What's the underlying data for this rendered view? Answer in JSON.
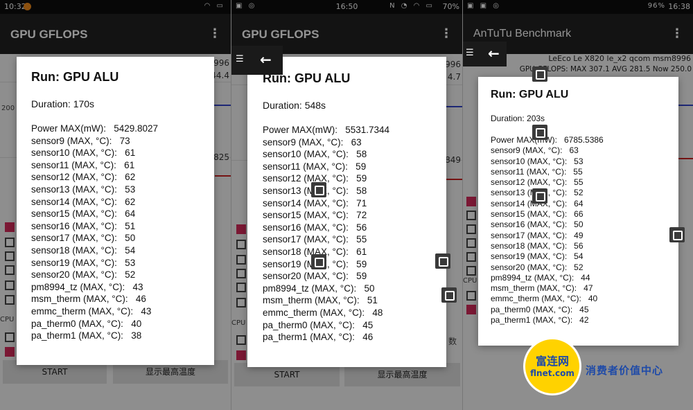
{
  "panel1": {
    "status": {
      "time": "10:32"
    },
    "app_title": "GPU GFLOPS",
    "bg": {
      "num_a": "996",
      "num_b": "44.4",
      "num_c": "825",
      "num_d": "CPU",
      "btn_start": "START",
      "btn_temp": "显示最高温度"
    },
    "dialog": {
      "title": "Run: GPU ALU",
      "duration": "Duration: 170s",
      "rows": [
        "Power MAX(mW):   5429.8027",
        "sensor9 (MAX, °C):   73",
        "sensor10 (MAX, °C):   61",
        "sensor11 (MAX, °C):   61",
        "sensor12 (MAX, °C):   62",
        "sensor13 (MAX, °C):   53",
        "sensor14 (MAX, °C):   62",
        "sensor15 (MAX, °C):   64",
        "sensor16 (MAX, °C):   51",
        "sensor17 (MAX, °C):   50",
        "sensor18 (MAX, °C):   54",
        "sensor19 (MAX, °C):   53",
        "sensor20 (MAX, °C):   52",
        "pm8994_tz (MAX, °C):   43",
        "msm_therm (MAX, °C):   46",
        "emmc_therm (MAX, °C):   43",
        "pa_therm0 (MAX, °C):   40",
        "pa_therm1 (MAX, °C):   38"
      ]
    }
  },
  "panel2": {
    "status": {
      "time": "16:50",
      "battery": "70%"
    },
    "app_title": "GPU GFLOPS",
    "bg": {
      "num_a": "996",
      "num_b": "4.7",
      "num_c": "849",
      "num_d": "CPU",
      "num_e": "数",
      "btn_start": "START",
      "btn_temp": "显示最高温度"
    },
    "dialog": {
      "title": "Run: GPU ALU",
      "duration": "Duration: 548s",
      "rows": [
        "Power MAX(mW):   5531.7344",
        "sensor9 (MAX, °C):   63",
        "sensor10 (MAX, °C):   58",
        "sensor11 (MAX, °C):   59",
        "sensor12 (MAX, °C):   59",
        "sensor13 (MAX, °C):   58",
        "sensor14 (MAX, °C):   71",
        "sensor15 (MAX, °C):   72",
        "sensor16 (MAX, °C):   56",
        "sensor17 (MAX, °C):   55",
        "sensor18 (MAX, °C):   61",
        "sensor19 (MAX, °C):   59",
        "sensor20 (MAX, °C):   59",
        "pm8994_tz (MAX, °C):   50",
        "msm_therm (MAX, °C):   51",
        "emmc_therm (MAX, °C):   48",
        "pa_therm0 (MAX, °C):   45",
        "pa_therm1 (MAX, °C):   46"
      ]
    }
  },
  "panel3": {
    "status": {
      "time": "16:38",
      "battery": "96%"
    },
    "app_title": "AnTuTu Benchmark",
    "device": "LeEco Le X820 le_x2 qcom msm8996",
    "gflops": "GPU GFLOPS: MAX 307.1 AVG 281.5 Now 250.0",
    "bg": {
      "num_d": "CPU"
    },
    "dialog": {
      "title": "Run: GPU ALU",
      "duration": "Duration: 203s",
      "rows": [
        "Power MAX(mW):   6785.5386",
        "sensor9 (MAX, °C):   63",
        "sensor10 (MAX, °C):   53",
        "sensor11 (MAX, °C):   55",
        "sensor12 (MAX, °C):   55",
        "sensor13 (MAX, °C):   52",
        "sensor14 (MAX, °C):   64",
        "sensor15 (MAX, °C):   66",
        "sensor16 (MAX, °C):   50",
        "sensor17 (MAX, °C):   49",
        "sensor18 (MAX, °C):   56",
        "sensor19 (MAX, °C):   54",
        "sensor20 (MAX, °C):   52",
        "pm8994_tz (MAX, °C):   44",
        "msm_therm (MAX, °C):   47",
        "emmc_therm (MAX, °C):   40",
        "pa_therm0 (MAX, °C):   45",
        "pa_therm1 (MAX, °C):   42"
      ]
    }
  },
  "watermark": {
    "cn": "富连网",
    "en": "flnet.com",
    "slogan": "消费者价值中心"
  },
  "icons": {
    "menu": "overflow-menu-icon",
    "back": "back-arrow-icon",
    "hamburger": "hamburger-icon",
    "float": "floating-window-icon"
  }
}
